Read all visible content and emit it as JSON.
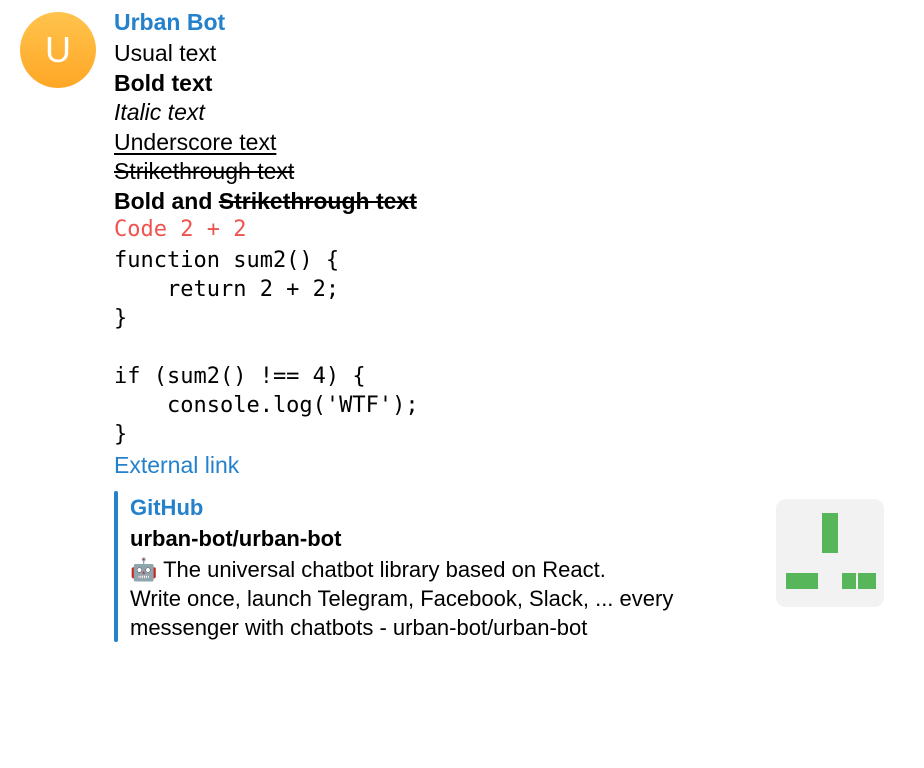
{
  "sender": {
    "name": "Urban Bot",
    "initial": "U"
  },
  "message": {
    "usual": "Usual text",
    "bold": "Bold text",
    "italic": "Italic text",
    "underscore": "Underscore text",
    "strike": "Strikethrough text",
    "bold_and": "Bold and ",
    "bold_strike": "Strikethrough text",
    "code_inline": "Code 2 + 2",
    "code_block": "function sum2() {\n    return 2 + 2;\n}\n\nif (sum2() !== 4) {\n    console.log('WTF');\n}",
    "link_text": "External link"
  },
  "preview": {
    "site": "GitHub",
    "title": "urban-bot/urban-bot",
    "emoji": "🤖",
    "description_l1": " The universal chatbot library based on React.",
    "description_rest": "Write once, launch Telegram, Facebook, Slack, ... every messenger with chatbots - urban-bot/urban-bot"
  }
}
